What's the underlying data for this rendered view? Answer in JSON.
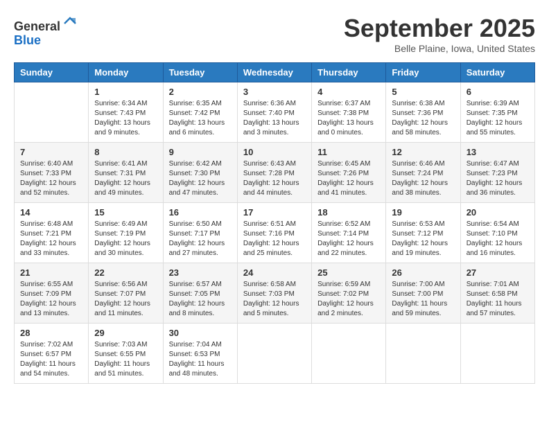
{
  "header": {
    "logo_line1": "General",
    "logo_line2": "Blue",
    "month_title": "September 2025",
    "location": "Belle Plaine, Iowa, United States"
  },
  "days_of_week": [
    "Sunday",
    "Monday",
    "Tuesday",
    "Wednesday",
    "Thursday",
    "Friday",
    "Saturday"
  ],
  "weeks": [
    [
      {
        "day": "",
        "info": ""
      },
      {
        "day": "1",
        "info": "Sunrise: 6:34 AM\nSunset: 7:43 PM\nDaylight: 13 hours\nand 9 minutes."
      },
      {
        "day": "2",
        "info": "Sunrise: 6:35 AM\nSunset: 7:42 PM\nDaylight: 13 hours\nand 6 minutes."
      },
      {
        "day": "3",
        "info": "Sunrise: 6:36 AM\nSunset: 7:40 PM\nDaylight: 13 hours\nand 3 minutes."
      },
      {
        "day": "4",
        "info": "Sunrise: 6:37 AM\nSunset: 7:38 PM\nDaylight: 13 hours\nand 0 minutes."
      },
      {
        "day": "5",
        "info": "Sunrise: 6:38 AM\nSunset: 7:36 PM\nDaylight: 12 hours\nand 58 minutes."
      },
      {
        "day": "6",
        "info": "Sunrise: 6:39 AM\nSunset: 7:35 PM\nDaylight: 12 hours\nand 55 minutes."
      }
    ],
    [
      {
        "day": "7",
        "info": "Sunrise: 6:40 AM\nSunset: 7:33 PM\nDaylight: 12 hours\nand 52 minutes."
      },
      {
        "day": "8",
        "info": "Sunrise: 6:41 AM\nSunset: 7:31 PM\nDaylight: 12 hours\nand 49 minutes."
      },
      {
        "day": "9",
        "info": "Sunrise: 6:42 AM\nSunset: 7:30 PM\nDaylight: 12 hours\nand 47 minutes."
      },
      {
        "day": "10",
        "info": "Sunrise: 6:43 AM\nSunset: 7:28 PM\nDaylight: 12 hours\nand 44 minutes."
      },
      {
        "day": "11",
        "info": "Sunrise: 6:45 AM\nSunset: 7:26 PM\nDaylight: 12 hours\nand 41 minutes."
      },
      {
        "day": "12",
        "info": "Sunrise: 6:46 AM\nSunset: 7:24 PM\nDaylight: 12 hours\nand 38 minutes."
      },
      {
        "day": "13",
        "info": "Sunrise: 6:47 AM\nSunset: 7:23 PM\nDaylight: 12 hours\nand 36 minutes."
      }
    ],
    [
      {
        "day": "14",
        "info": "Sunrise: 6:48 AM\nSunset: 7:21 PM\nDaylight: 12 hours\nand 33 minutes."
      },
      {
        "day": "15",
        "info": "Sunrise: 6:49 AM\nSunset: 7:19 PM\nDaylight: 12 hours\nand 30 minutes."
      },
      {
        "day": "16",
        "info": "Sunrise: 6:50 AM\nSunset: 7:17 PM\nDaylight: 12 hours\nand 27 minutes."
      },
      {
        "day": "17",
        "info": "Sunrise: 6:51 AM\nSunset: 7:16 PM\nDaylight: 12 hours\nand 25 minutes."
      },
      {
        "day": "18",
        "info": "Sunrise: 6:52 AM\nSunset: 7:14 PM\nDaylight: 12 hours\nand 22 minutes."
      },
      {
        "day": "19",
        "info": "Sunrise: 6:53 AM\nSunset: 7:12 PM\nDaylight: 12 hours\nand 19 minutes."
      },
      {
        "day": "20",
        "info": "Sunrise: 6:54 AM\nSunset: 7:10 PM\nDaylight: 12 hours\nand 16 minutes."
      }
    ],
    [
      {
        "day": "21",
        "info": "Sunrise: 6:55 AM\nSunset: 7:09 PM\nDaylight: 12 hours\nand 13 minutes."
      },
      {
        "day": "22",
        "info": "Sunrise: 6:56 AM\nSunset: 7:07 PM\nDaylight: 12 hours\nand 11 minutes."
      },
      {
        "day": "23",
        "info": "Sunrise: 6:57 AM\nSunset: 7:05 PM\nDaylight: 12 hours\nand 8 minutes."
      },
      {
        "day": "24",
        "info": "Sunrise: 6:58 AM\nSunset: 7:03 PM\nDaylight: 12 hours\nand 5 minutes."
      },
      {
        "day": "25",
        "info": "Sunrise: 6:59 AM\nSunset: 7:02 PM\nDaylight: 12 hours\nand 2 minutes."
      },
      {
        "day": "26",
        "info": "Sunrise: 7:00 AM\nSunset: 7:00 PM\nDaylight: 11 hours\nand 59 minutes."
      },
      {
        "day": "27",
        "info": "Sunrise: 7:01 AM\nSunset: 6:58 PM\nDaylight: 11 hours\nand 57 minutes."
      }
    ],
    [
      {
        "day": "28",
        "info": "Sunrise: 7:02 AM\nSunset: 6:57 PM\nDaylight: 11 hours\nand 54 minutes."
      },
      {
        "day": "29",
        "info": "Sunrise: 7:03 AM\nSunset: 6:55 PM\nDaylight: 11 hours\nand 51 minutes."
      },
      {
        "day": "30",
        "info": "Sunrise: 7:04 AM\nSunset: 6:53 PM\nDaylight: 11 hours\nand 48 minutes."
      },
      {
        "day": "",
        "info": ""
      },
      {
        "day": "",
        "info": ""
      },
      {
        "day": "",
        "info": ""
      },
      {
        "day": "",
        "info": ""
      }
    ]
  ]
}
